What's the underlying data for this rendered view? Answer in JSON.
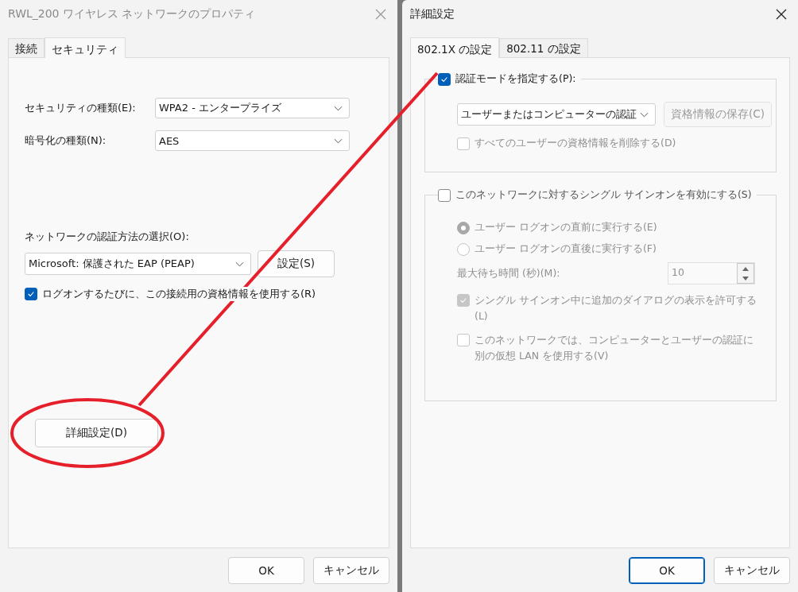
{
  "left_window": {
    "title": "RWL_200 ワイヤレス ネットワークのプロパティ",
    "active": false,
    "tabs": [
      {
        "label": "接続",
        "selected": false
      },
      {
        "label": "セキュリティ",
        "selected": true
      }
    ],
    "fields": [
      {
        "label": "セキュリティの種類(E):",
        "value": "WPA2 - エンタープライズ"
      },
      {
        "label": "暗号化の種類(N):",
        "value": "AES"
      }
    ],
    "auth_method": {
      "label": "ネットワークの認証方法の選択(O):",
      "value": "Microsoft: 保護された EAP (PEAP)",
      "button": "設定(S)"
    },
    "remember_credentials": {
      "label": "ログオンするたびに、この接続用の資格情報を使用する(R)",
      "checked": true
    },
    "advanced_button": "詳細設定(D)",
    "buttons": [
      {
        "label": "OK",
        "default": false
      },
      {
        "label": "キャンセル",
        "default": false
      }
    ]
  },
  "right_window": {
    "title": "詳細設定",
    "active": true,
    "tabs": [
      {
        "label": "802.1X の設定",
        "selected": true
      },
      {
        "label": "802.11 の設定",
        "selected": false
      }
    ],
    "auth_group": {
      "checkbox": {
        "label": "認証モードを指定する(P):",
        "checked": true
      },
      "mode": "ユーザーまたはコンピューターの認証",
      "save_button": {
        "label": "資格情報の保存(C)",
        "disabled": true
      },
      "delete_all": {
        "label": "すべてのユーザーの資格情報を削除する(D)",
        "checked": false,
        "disabled": true
      }
    },
    "sso_group": {
      "checkbox": {
        "label": "このネットワークに対するシングル サインオンを有効にする(S)",
        "checked": false
      },
      "items": [
        {
          "kind": "radio",
          "label": "ユーザー ログオンの直前に実行する(E)",
          "selected": true,
          "disabled": true
        },
        {
          "kind": "radio",
          "label": "ユーザー ログオンの直後に実行する(F)",
          "selected": false,
          "disabled": true
        },
        {
          "kind": "spin",
          "label": "最大待ち時間 (秒)(M):",
          "value": "10",
          "disabled": true
        },
        {
          "kind": "checkbox",
          "label": "シングル サインオン中に追加のダイアログの表示を許可する(L)",
          "checked": true,
          "disabled": true
        },
        {
          "kind": "checkbox",
          "label": "このネットワークでは、コンピューターとユーザーの認証に別の仮想 LAN を使用する(V)",
          "checked": false,
          "disabled": true
        }
      ]
    },
    "buttons": [
      {
        "label": "OK",
        "default": true
      },
      {
        "label": "キャンセル",
        "default": false
      }
    ]
  }
}
